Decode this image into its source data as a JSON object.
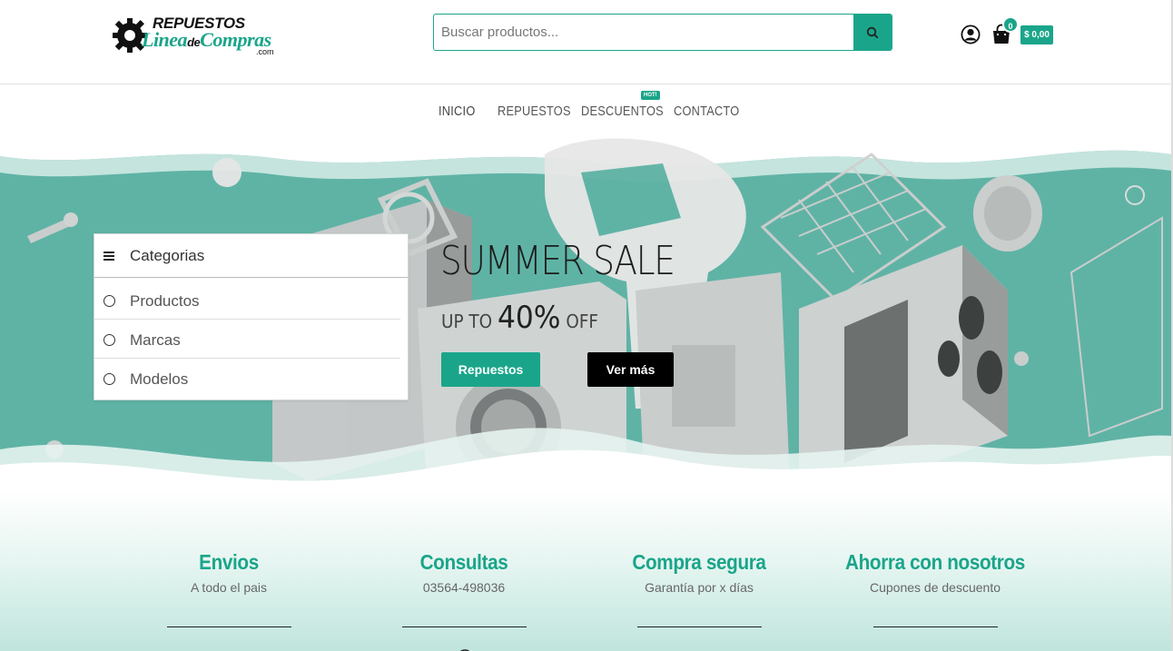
{
  "header": {
    "logo": {
      "line1": "REPUESTOS",
      "line2_a": "Linea",
      "line2_b": "de",
      "line2_c": "Compras",
      "line3": ".com"
    },
    "search": {
      "placeholder": "Buscar productos..."
    },
    "cart": {
      "count": "0",
      "total": "$ 0,00"
    }
  },
  "nav": {
    "items": [
      {
        "label": "INICIO"
      },
      {
        "label": "REPUESTOS"
      },
      {
        "label": "DESCUENTOS"
      },
      {
        "label": "CONTACTO"
      }
    ],
    "hot_badge": "HOT!"
  },
  "categories": {
    "title": "Categorias",
    "items": [
      {
        "label": "Productos"
      },
      {
        "label": "Marcas"
      },
      {
        "label": "Modelos"
      }
    ]
  },
  "hero": {
    "title": "SUMMER SALE",
    "sub_prefix": "UP TO",
    "sub_value": "40%",
    "sub_suffix": "OFF",
    "button_primary": "Repuestos",
    "button_secondary": "Ver más"
  },
  "features": [
    {
      "title": "Envios",
      "subtitle": "A todo el pais"
    },
    {
      "title": "Consultas",
      "subtitle": "03564-498036"
    },
    {
      "title": "Compra segura",
      "subtitle": "Garantía por x días"
    },
    {
      "title": "Ahorra con nosotros",
      "subtitle": "Cupones de descuento"
    }
  ],
  "colors": {
    "accent": "#1aa58a",
    "hero_bg": "#5fb3a5",
    "dark": "#000000"
  }
}
